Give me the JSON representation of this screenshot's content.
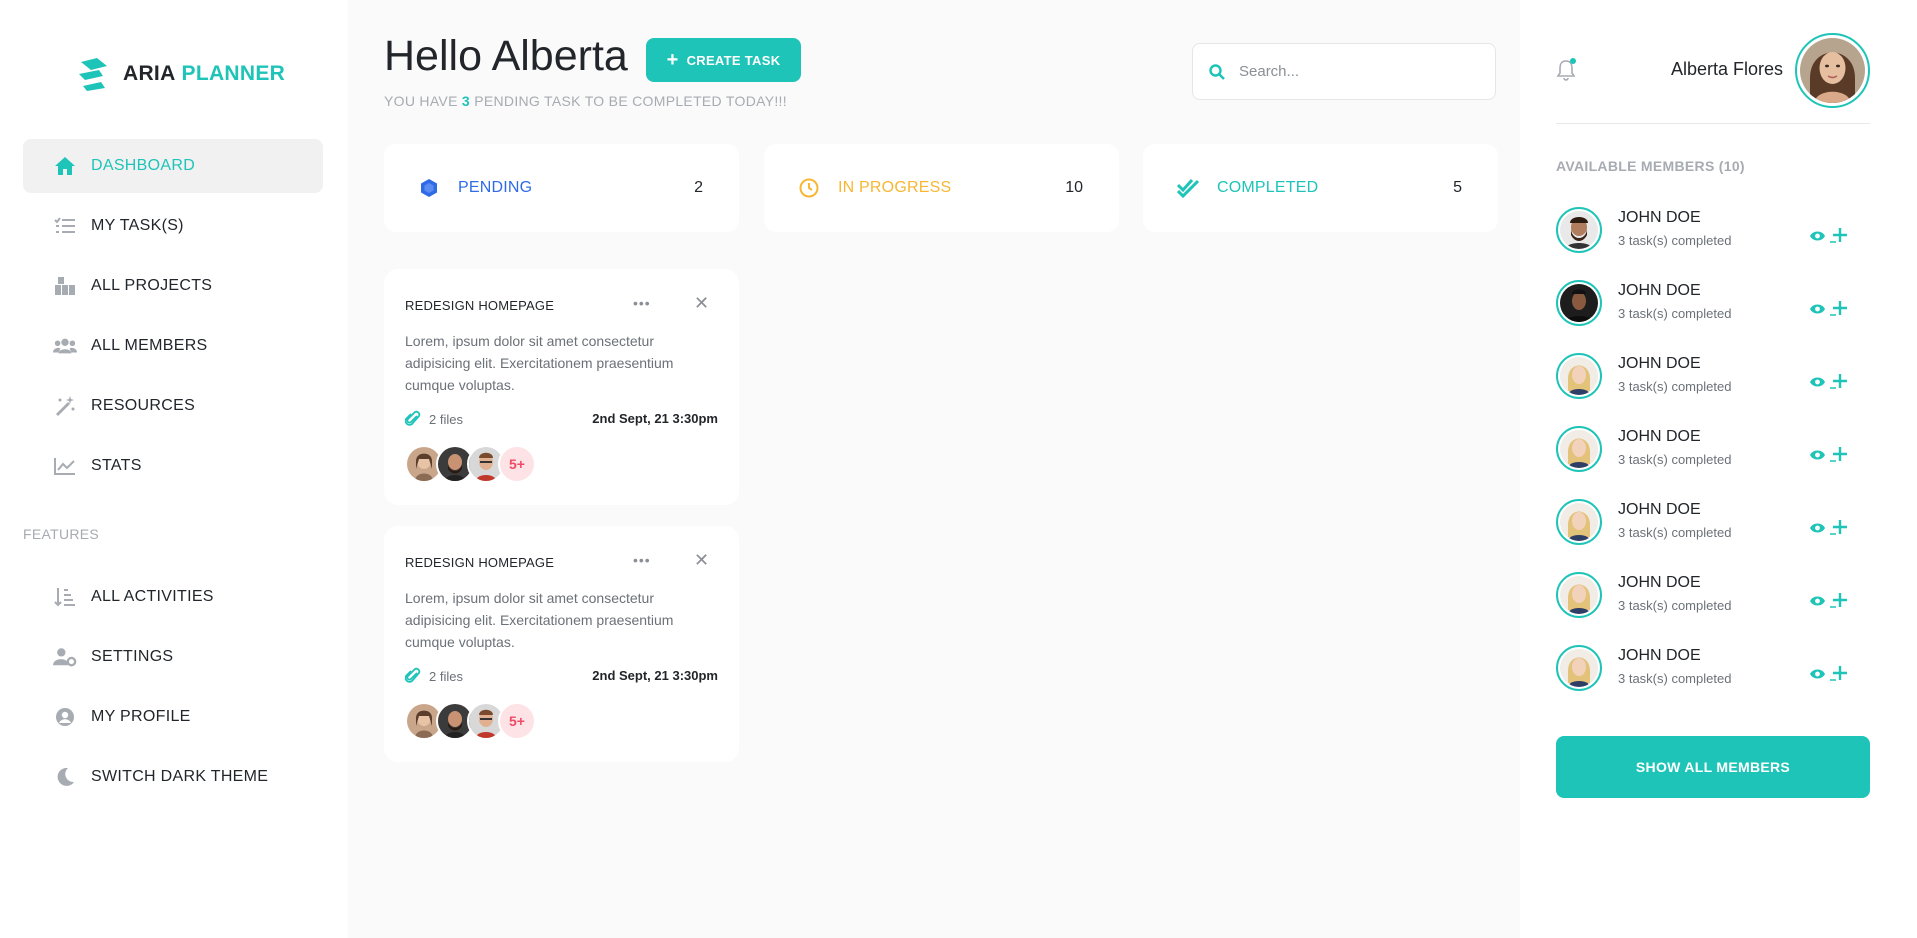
{
  "brand": {
    "name_part1": "ARIA",
    "name_part2": "PLANNER",
    "accent": "#1ec4b8"
  },
  "sidebar": {
    "main_items": [
      {
        "label": "DASHBOARD",
        "icon": "home-icon",
        "active": true
      },
      {
        "label": "MY TASK(S)",
        "icon": "task-list-icon",
        "active": false
      },
      {
        "label": "ALL PROJECTS",
        "icon": "projects-icon",
        "active": false
      },
      {
        "label": "ALL MEMBERS",
        "icon": "users-icon",
        "active": false
      },
      {
        "label": "RESOURCES",
        "icon": "magic-wand-icon",
        "active": false
      },
      {
        "label": "STATS",
        "icon": "chart-icon",
        "active": false
      }
    ],
    "features_label": "FEATURES",
    "feature_items": [
      {
        "label": "ALL ACTIVITIES",
        "icon": "sort-list-icon"
      },
      {
        "label": "SETTINGS",
        "icon": "user-settings-icon"
      },
      {
        "label": "MY PROFILE",
        "icon": "user-circle-icon"
      },
      {
        "label": "SWITCH DARK THEME",
        "icon": "moon-icon"
      }
    ]
  },
  "header": {
    "greeting": "Hello Alberta",
    "create_task_label": "CREATE TASK",
    "subtitle_prefix": "YOU HAVE",
    "pending_count": "3",
    "subtitle_suffix": "PENDING TASK TO BE COMPLETED TODAY!!!",
    "search_placeholder": "Search..."
  },
  "stats": [
    {
      "label": "PENDING",
      "count": "2",
      "color": "#2f6be6",
      "icon": "cube-icon"
    },
    {
      "label": "IN PROGRESS",
      "count": "10",
      "color": "#f7b733",
      "icon": "clock-icon"
    },
    {
      "label": "COMPLETED",
      "count": "5",
      "color": "#1ec4b8",
      "icon": "double-check-icon"
    }
  ],
  "tasks": [
    {
      "title": "REDESIGN HOMEPAGE",
      "description": "Lorem, ipsum dolor sit amet consectetur adipisicing elit. Exercitationem praesentium cumque voluptas.",
      "files": "2 files",
      "date": "2nd Sept, 21 3:30pm",
      "more_members": "5+"
    },
    {
      "title": "REDESIGN HOMEPAGE",
      "description": "Lorem, ipsum dolor sit amet consectetur adipisicing elit. Exercitationem praesentium cumque voluptas.",
      "files": "2 files",
      "date": "2nd Sept, 21 3:30pm",
      "more_members": "5+"
    }
  ],
  "user": {
    "name": "Alberta Flores"
  },
  "members": {
    "title": "AVAILABLE MEMBERS (10)",
    "list": [
      {
        "name": "JOHN DOE",
        "tasks": "3 task(s) completed"
      },
      {
        "name": "JOHN DOE",
        "tasks": "3 task(s) completed"
      },
      {
        "name": "JOHN DOE",
        "tasks": "3 task(s) completed"
      },
      {
        "name": "JOHN DOE",
        "tasks": "3 task(s) completed"
      },
      {
        "name": "JOHN DOE",
        "tasks": "3 task(s) completed"
      },
      {
        "name": "JOHN DOE",
        "tasks": "3 task(s) completed"
      },
      {
        "name": "JOHN DOE",
        "tasks": "3 task(s) completed"
      }
    ],
    "show_all_label": "SHOW ALL MEMBERS"
  }
}
